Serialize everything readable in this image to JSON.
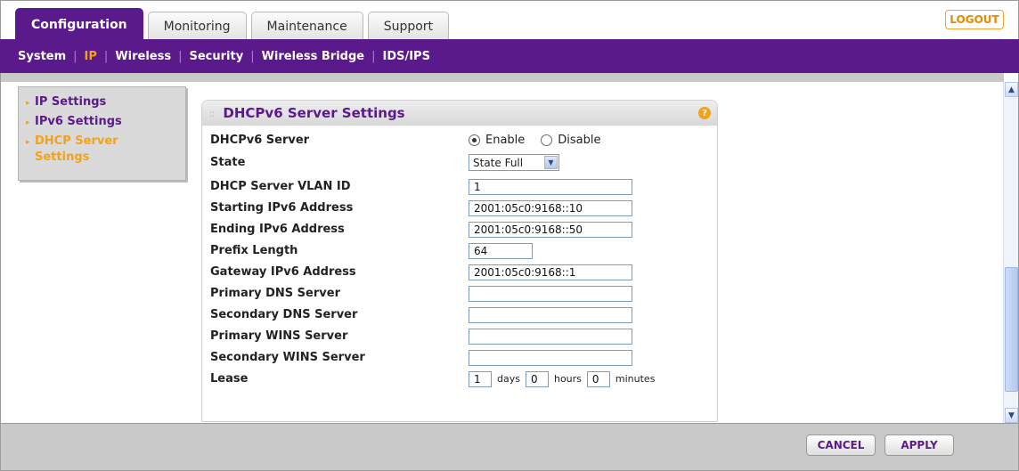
{
  "tabs": [
    "Configuration",
    "Monitoring",
    "Maintenance",
    "Support"
  ],
  "logout_label": "LOGOUT",
  "subnav": [
    "System",
    "IP",
    "Wireless",
    "Security",
    "Wireless Bridge",
    "IDS/IPS"
  ],
  "sidebar": {
    "items": [
      {
        "label": "IP Settings"
      },
      {
        "label": "IPv6 Settings"
      },
      {
        "label": "DHCP Server Settings"
      }
    ]
  },
  "panel": {
    "title": "DHCPv6 Server Settings",
    "help_icon": "?"
  },
  "form": {
    "dhcpv6_server": {
      "label": "DHCPv6 Server",
      "options": [
        "Enable",
        "Disable"
      ],
      "selected": "Enable"
    },
    "state": {
      "label": "State",
      "value": "State Full"
    },
    "vlan_id": {
      "label": "DHCP Server VLAN ID",
      "value": "1"
    },
    "start_addr": {
      "label": "Starting IPv6 Address",
      "value": "2001:05c0:9168::10"
    },
    "end_addr": {
      "label": "Ending IPv6 Address",
      "value": "2001:05c0:9168::50"
    },
    "prefix_len": {
      "label": "Prefix Length",
      "value": "64"
    },
    "gateway": {
      "label": "Gateway IPv6 Address",
      "value": "2001:05c0:9168::1"
    },
    "primary_dns": {
      "label": "Primary DNS Server",
      "value": ""
    },
    "secondary_dns": {
      "label": "Secondary DNS Server",
      "value": ""
    },
    "primary_wins": {
      "label": "Primary WINS Server",
      "value": ""
    },
    "secondary_wins": {
      "label": "Secondary WINS Server",
      "value": ""
    },
    "lease": {
      "label": "Lease",
      "days": "1",
      "days_unit": "days",
      "hours": "0",
      "hours_unit": "hours",
      "minutes": "0",
      "minutes_unit": "minutes"
    }
  },
  "buttons": {
    "cancel": "CANCEL",
    "apply": "APPLY"
  },
  "colors": {
    "brand_purple": "#5b1a8c",
    "accent_orange": "#f3a21b"
  }
}
